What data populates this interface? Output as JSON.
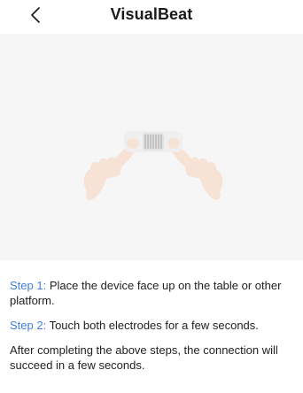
{
  "header": {
    "title": "VisualBeat",
    "back_icon": "chevron-left-icon"
  },
  "illustration": {
    "icon": "hands-touching-device-icon",
    "colors": {
      "skin": "#f7e3d6",
      "device": "#efefef",
      "electrode": "#a9a9a9"
    }
  },
  "instructions": {
    "step1_label": "Step 1:",
    "step1_text": " Place the device face up on the table or other platform.",
    "step2_label": "Step 2:",
    "step2_text": " Touch both electrodes for a few seconds.",
    "note": "After completing the above steps, the connection will succeed in a few seconds."
  },
  "colors": {
    "accent": "#3f7fe0",
    "text": "#222222",
    "panel_background": "#f6f6f6"
  }
}
